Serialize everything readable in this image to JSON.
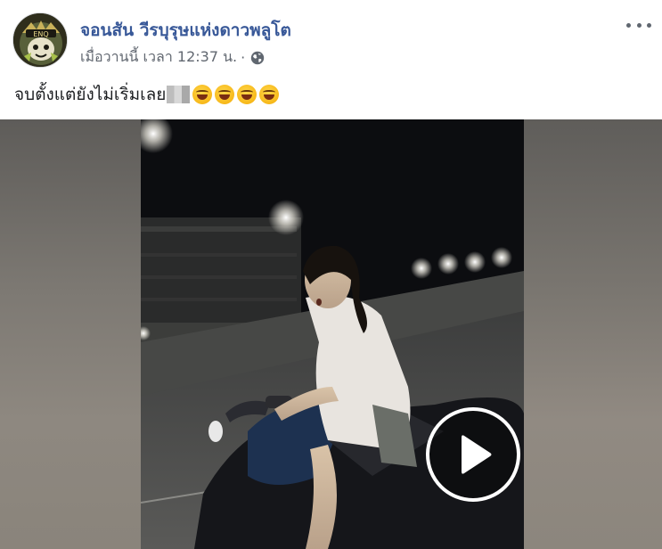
{
  "post": {
    "author": "จอนสัน วีรบุรุษแห่งดาวพลูโต",
    "timestamp": "เมื่อวานนี้ เวลา 12:37 น.",
    "separator": "·",
    "privacy_icon": "globe-icon",
    "more_icon": "more-options-icon",
    "text": "จบตั้งแต่ยังไม่เริ่มเลย",
    "emojis": [
      "rolling-on-floor-laughing",
      "rolling-on-floor-laughing",
      "rolling-on-floor-laughing",
      "rolling-on-floor-laughing"
    ]
  },
  "video": {
    "play_icon": "play-icon"
  },
  "colors": {
    "author_link": "#385898",
    "meta_text": "#616770",
    "body_text": "#1c1e21"
  }
}
